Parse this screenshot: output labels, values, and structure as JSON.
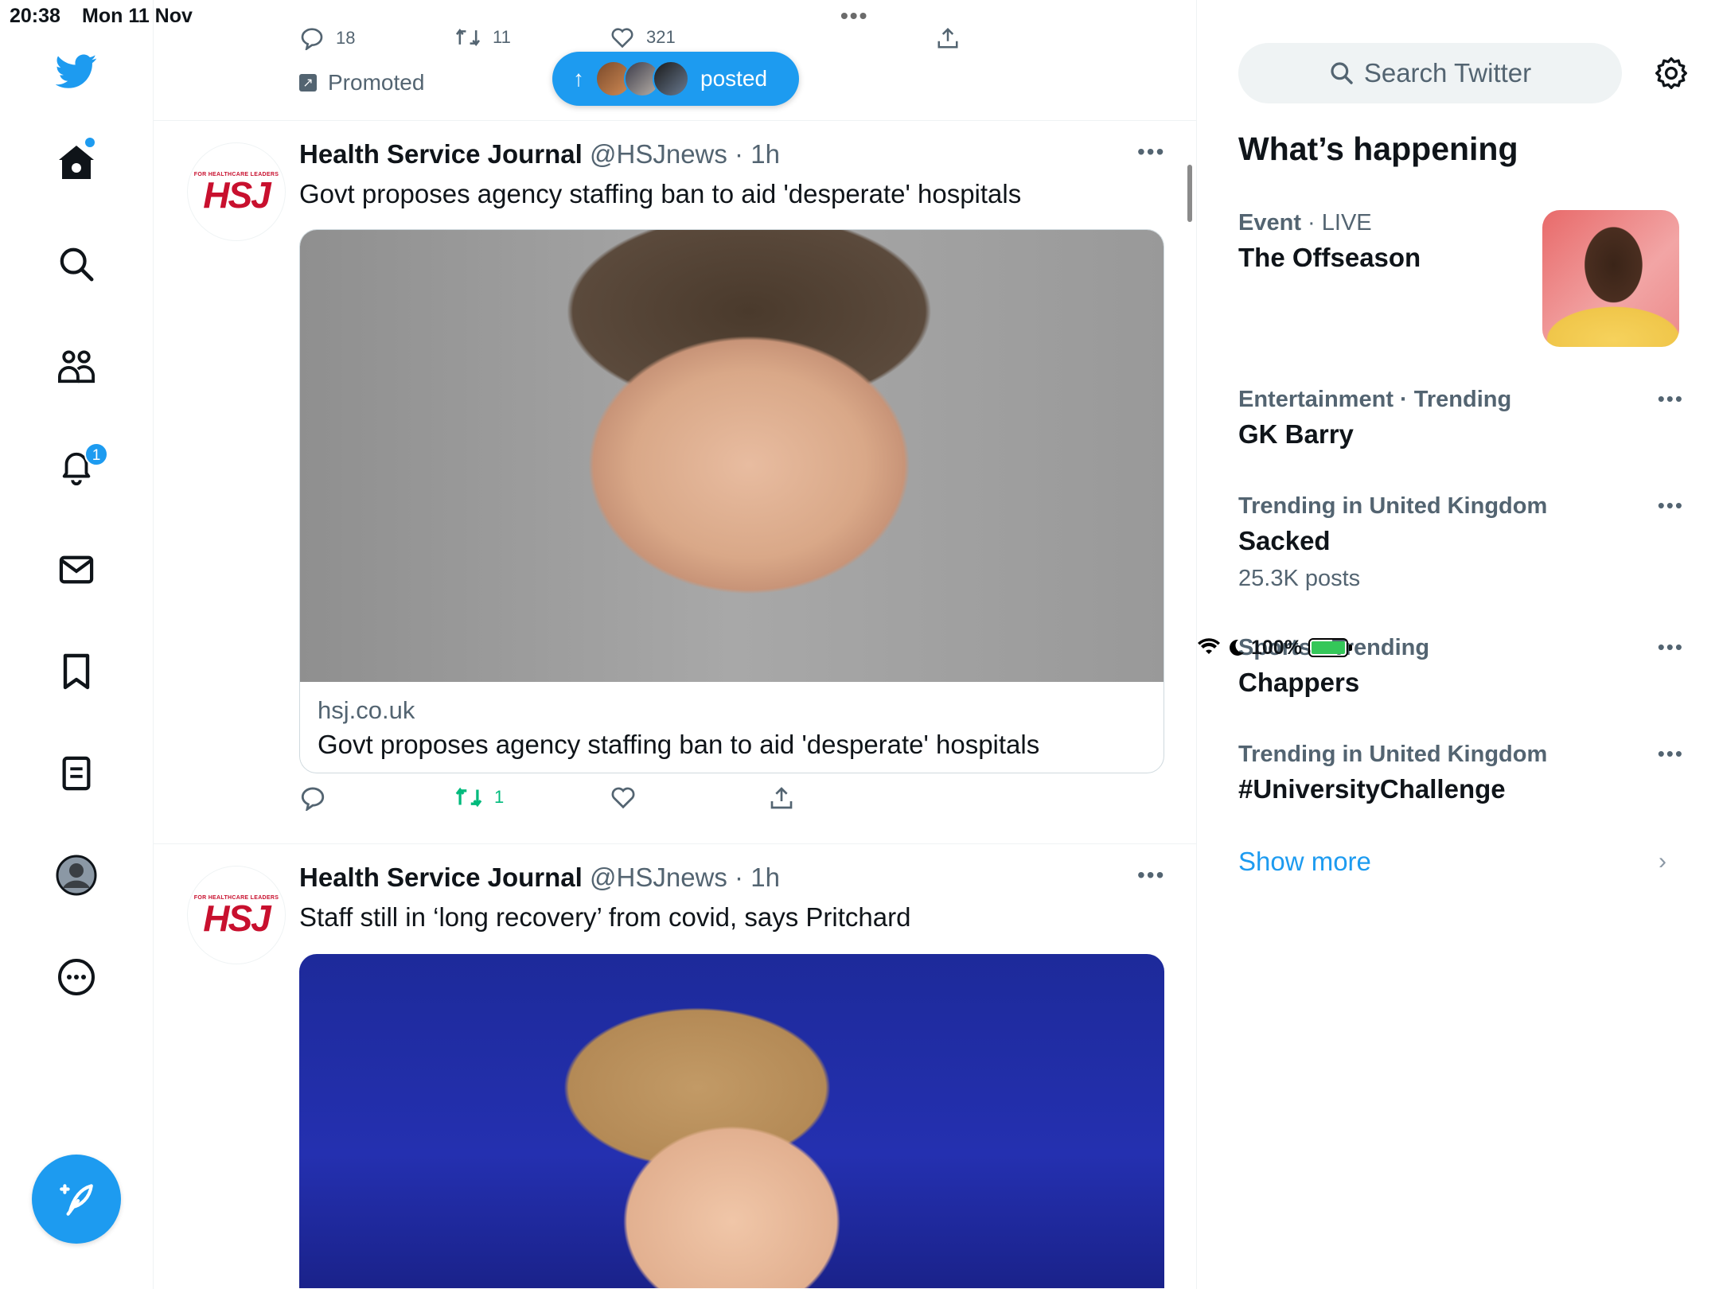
{
  "status_bar": {
    "time": "20:38",
    "date": "Mon 11 Nov",
    "battery": "100%",
    "window_dots": "•••"
  },
  "nav": {
    "notifications_badge": "1",
    "icons": [
      "twitter-logo-icon",
      "home-icon",
      "search-icon",
      "communities-icon",
      "notifications-icon",
      "messages-icon",
      "bookmarks-icon",
      "lists-icon",
      "profile-icon",
      "more-icon",
      "compose-icon"
    ]
  },
  "previous_tweet": {
    "replies": "18",
    "retweets": "11",
    "likes": "321",
    "promoted_label": "Promoted"
  },
  "new_posts_pill": {
    "label": "posted"
  },
  "tweets": [
    {
      "name": "Health Service Journal",
      "handle": "@HSJnews",
      "time": "1h",
      "text": "Govt proposes agency staffing ban to aid 'desperate' hospitals",
      "avatar_small_text": "FOR HEALTHCARE LEADERS",
      "avatar_logo": "HSJ",
      "card": {
        "domain": "hsj.co.uk",
        "title": "Govt proposes agency staffing ban to aid 'desperate' hospitals"
      },
      "retweets": "1"
    },
    {
      "name": "Health Service Journal",
      "handle": "@HSJnews",
      "time": "1h",
      "text": "Staff still in ‘long recovery’ from covid, says Pritchard",
      "avatar_small_text": "FOR HEALTHCARE LEADERS",
      "avatar_logo": "HSJ"
    }
  ],
  "sidebar": {
    "search_placeholder": "Search Twitter",
    "heading": "What’s happening",
    "event": {
      "category": "Event",
      "status": "LIVE",
      "title": "The Offseason"
    },
    "trends": [
      {
        "category": "Entertainment · Trending",
        "topic": "GK Barry",
        "count": ""
      },
      {
        "category": "Trending in United Kingdom",
        "topic": "Sacked",
        "count": "25.3K posts"
      },
      {
        "category": "Sports · Trending",
        "topic": "Chappers",
        "count": ""
      },
      {
        "category": "Trending in United Kingdom",
        "topic": "#UniversityChallenge",
        "count": ""
      }
    ],
    "show_more": "Show more"
  },
  "colors": {
    "accent": "#1d9bf0",
    "retweet_green": "#00ba7c",
    "secondary_text": "#536471",
    "hsj_red": "#c8102e"
  }
}
